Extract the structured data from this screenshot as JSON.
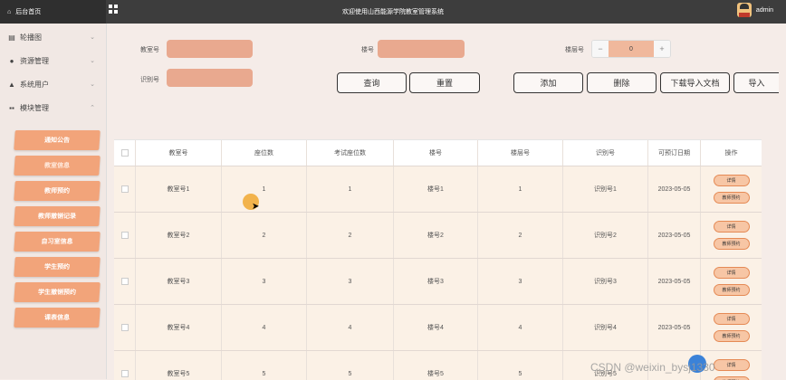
{
  "topbar": {
    "home_label": "后台首页",
    "title": "欢迎使用山西能源学院教室管理系统",
    "user": "admin"
  },
  "sidebar": {
    "menus": [
      {
        "icon": "▤",
        "label": "轮播图"
      },
      {
        "icon": "●",
        "label": "资源管理"
      },
      {
        "icon": "▲",
        "label": "系统用户"
      },
      {
        "icon": "▪▪",
        "label": "模块管理"
      }
    ],
    "submenu": [
      "通知公告",
      "教室信息",
      "教师预约",
      "教师撤销记录",
      "自习室信息",
      "学生预约",
      "学生撤销预约",
      "课表信息"
    ]
  },
  "filters": {
    "classroom_no_label": "教室号",
    "building_no_label": "楼号",
    "floor_no_label": "楼层号",
    "floor_value": "0",
    "recognition_no_label": "识别号"
  },
  "buttons": {
    "query": "查询",
    "reset": "重置",
    "add": "添加",
    "delete": "删除",
    "download": "下载导入文档",
    "import": "导入"
  },
  "table": {
    "headers": [
      "教室号",
      "座位数",
      "考试座位数",
      "楼号",
      "楼层号",
      "识别号",
      "可预订日期",
      "操作"
    ],
    "actions": {
      "detail": "详情",
      "reserve": "教师预约"
    },
    "rows": [
      [
        "教室号1",
        "1",
        "1",
        "楼号1",
        "1",
        "识别号1",
        "2023-05-05"
      ],
      [
        "教室号2",
        "2",
        "2",
        "楼号2",
        "2",
        "识别号2",
        "2023-05-05"
      ],
      [
        "教室号3",
        "3",
        "3",
        "楼号3",
        "3",
        "识别号3",
        "2023-05-05"
      ],
      [
        "教室号4",
        "4",
        "4",
        "楼号4",
        "4",
        "识别号4",
        "2023-05-05"
      ],
      [
        "教室号5",
        "5",
        "5",
        "楼号5",
        "5",
        "识别号5",
        ""
      ]
    ]
  },
  "watermark": "CSDN @weixin_bysj1330"
}
